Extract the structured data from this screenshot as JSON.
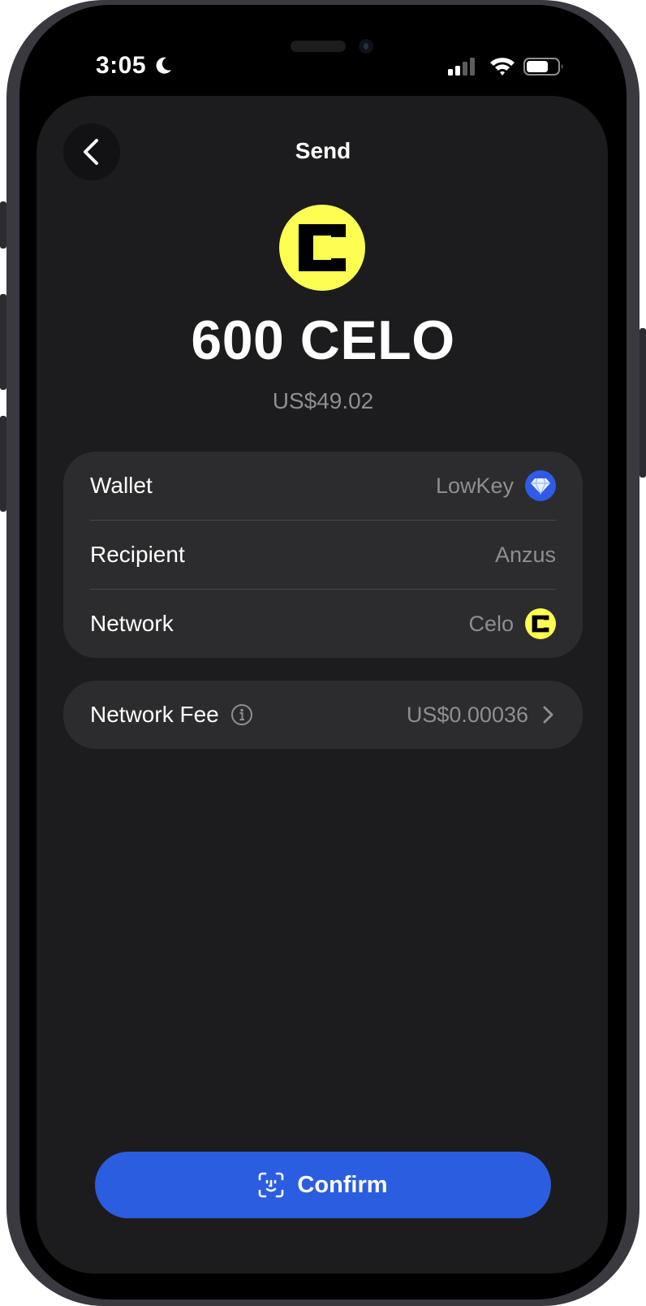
{
  "status_bar": {
    "time": "3:05"
  },
  "header": {
    "title": "Send"
  },
  "token": {
    "amount": "600 CELO",
    "fiat_value": "US$49.02"
  },
  "details": {
    "wallet": {
      "label": "Wallet",
      "value": "LowKey"
    },
    "recipient": {
      "label": "Recipient",
      "value": "Anzus"
    },
    "network": {
      "label": "Network",
      "value": "Celo"
    }
  },
  "fee": {
    "label": "Network Fee",
    "value": "US$0.00036"
  },
  "actions": {
    "confirm_label": "Confirm"
  },
  "colors": {
    "accent": "#2b5de0",
    "celo_yellow": "#fcff52",
    "background": "#1c1c1e",
    "card": "#2c2c2e",
    "secondary_text": "#8e8e93"
  },
  "icons": [
    "back-chevron-icon",
    "celo-logo-icon",
    "diamond-icon",
    "info-icon",
    "chevron-right-icon",
    "face-id-icon",
    "moon-icon",
    "signal-icon",
    "wifi-icon",
    "battery-icon"
  ]
}
